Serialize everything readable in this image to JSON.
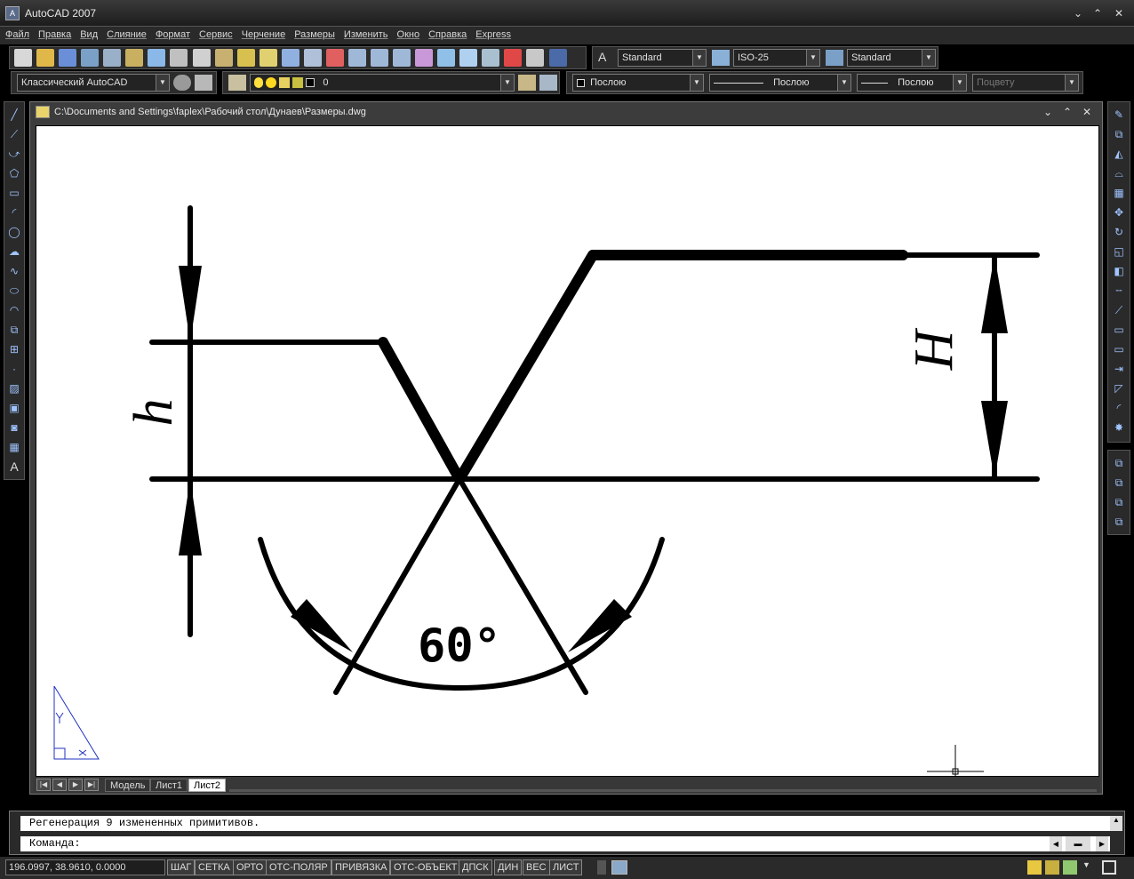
{
  "app": {
    "title": "AutoCAD 2007"
  },
  "menu": [
    "Файл",
    "Правка",
    "Вид",
    "Слияние",
    "Формат",
    "Сервис",
    "Черчение",
    "Размеры",
    "Изменить",
    "Окно",
    "Справка",
    "Express"
  ],
  "toolbar_styles": {
    "text_style": "Standard",
    "dim_style": "ISO-25",
    "table_style": "Standard"
  },
  "toolbar_layers": {
    "workspace": "Классический AutoCAD",
    "layer": "0",
    "color": "Послою",
    "linetype": "Послою",
    "lineweight": "Послою",
    "plotstyle": "Поцвету"
  },
  "drawing": {
    "path": "C:\\Documents and Settings\\faplex\\Рабочий стол\\Дунаев\\Размеры.dwg",
    "dim_small": "h",
    "dim_large": "H",
    "angle_label": "60°"
  },
  "tabs": [
    "Модель",
    "Лист1",
    "Лист2"
  ],
  "active_tab": "Лист2",
  "command": {
    "history": "Регенерация 9 измененных примитивов.",
    "prompt": "Команда:"
  },
  "status": {
    "coords": "196.0997, 38.9610, 0.0000",
    "buttons": [
      "ШАГ",
      "СЕТКА",
      "ОРТО",
      "ОТС-ПОЛЯР",
      "ПРИВЯЗКА",
      "ОТС-ОБЪЕКТ",
      "ДПСК",
      "ДИН",
      "ВЕС",
      "ЛИСТ"
    ]
  },
  "icons": {
    "app": "autocad-logo-icon",
    "drawing_file": "dwg-file-icon"
  }
}
